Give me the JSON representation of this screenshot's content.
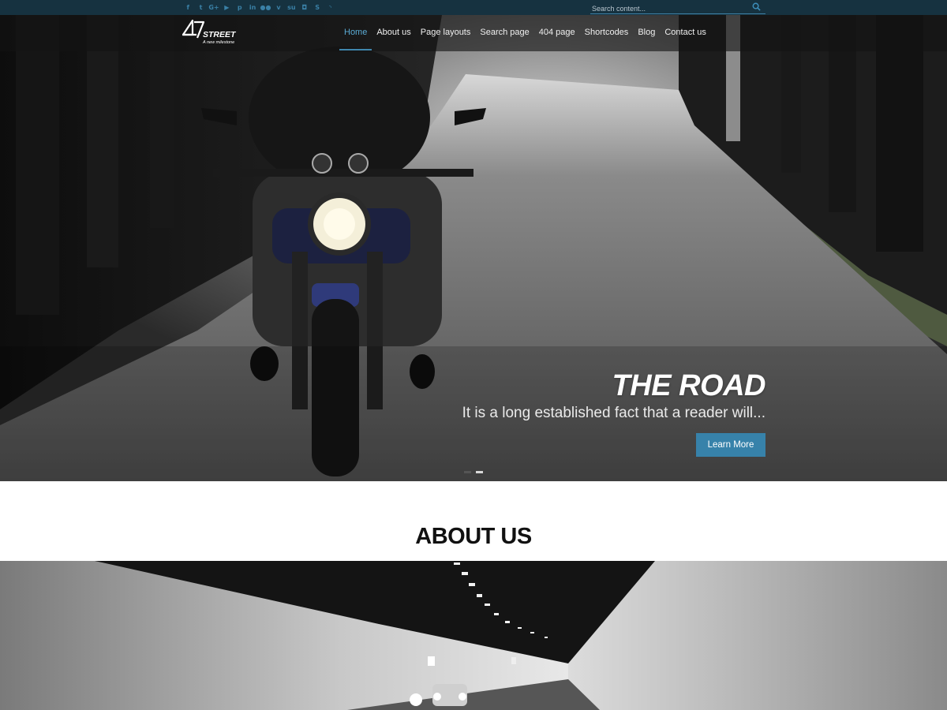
{
  "topbar": {
    "social_icons": [
      {
        "name": "facebook-icon",
        "glyph": "f"
      },
      {
        "name": "twitter-icon",
        "glyph": "t"
      },
      {
        "name": "google-plus-icon",
        "glyph": "G+"
      },
      {
        "name": "youtube-icon",
        "glyph": "▶"
      },
      {
        "name": "pinterest-icon",
        "glyph": "p"
      },
      {
        "name": "linkedin-icon",
        "glyph": "in"
      },
      {
        "name": "flickr-icon",
        "glyph": "●●"
      },
      {
        "name": "vimeo-icon",
        "glyph": "v"
      },
      {
        "name": "stumbleupon-icon",
        "glyph": "su"
      },
      {
        "name": "instagram-icon",
        "glyph": "◘"
      },
      {
        "name": "skype-icon",
        "glyph": "S"
      },
      {
        "name": "rss-icon",
        "glyph": "◝"
      }
    ],
    "search": {
      "placeholder": "Search content..."
    }
  },
  "header": {
    "logo": {
      "mark": "47",
      "name": "STREET",
      "tagline": "A new milestone"
    },
    "nav": [
      "Home",
      "About us",
      "Page layouts",
      "Search page",
      "404 page",
      "Shortcodes",
      "Blog",
      "Contact us"
    ],
    "active_index": 0
  },
  "hero": {
    "title": "THE ROAD",
    "subtitle": "It is a long established fact that a reader will...",
    "button": "Learn More",
    "slides": 2,
    "active_slide": 1
  },
  "about": {
    "heading": "ABOUT US"
  },
  "colors": {
    "topbar": "#163240",
    "accent": "#3782aa",
    "nav_active": "#5aaad3",
    "heading": "#111111"
  }
}
